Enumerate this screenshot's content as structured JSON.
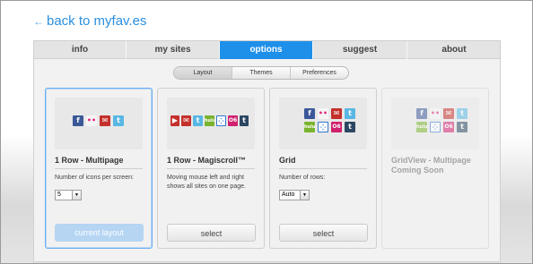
{
  "back_link": {
    "arrow": "←",
    "label": "back to myfav.es"
  },
  "tabs": [
    {
      "label": "info",
      "active": false
    },
    {
      "label": "my sites",
      "active": false
    },
    {
      "label": "options",
      "active": true
    },
    {
      "label": "suggest",
      "active": false
    },
    {
      "label": "about",
      "active": false
    }
  ],
  "subtabs": [
    {
      "label": "Layout",
      "active": true
    },
    {
      "label": "Themes",
      "active": false
    },
    {
      "label": "Preferences",
      "active": false
    }
  ],
  "cards": [
    {
      "title": "1 Row - Multipage",
      "desc": "Number of icons per screen:",
      "select_value": "5",
      "action": "current layout",
      "state": "selected"
    },
    {
      "title": "1 Row - Magiscroll™",
      "desc": "Moving mouse left and right shows all sites on one page.",
      "action": "select",
      "state": "normal"
    },
    {
      "title": "Grid",
      "desc": "Number of rows:",
      "select_value": "Auto",
      "action": "select",
      "state": "normal"
    },
    {
      "title": "GridView - Multipage Coming Soon",
      "state": "disabled"
    }
  ],
  "icon_glyphs": {
    "facebook": "f",
    "flickr": "••",
    "gmail": "✉",
    "twitter": "t",
    "youtube": "▶",
    "hulu": "hulu",
    "delicious": "⁘",
    "orkut": "O6",
    "tumblr": "t"
  },
  "colors": {
    "accent": "#1e90ea",
    "link": "#2a8fe0",
    "facebook": "#3b5998",
    "flickr_bg": "#f5f5f5",
    "gmail": "#c4302b",
    "twitter": "#59b7e3",
    "youtube": "#d93030",
    "hulu": "#7ab32e",
    "delicious_bg": "#ffffff",
    "orkut": "#d0216e",
    "tumblr": "#2c4762"
  }
}
